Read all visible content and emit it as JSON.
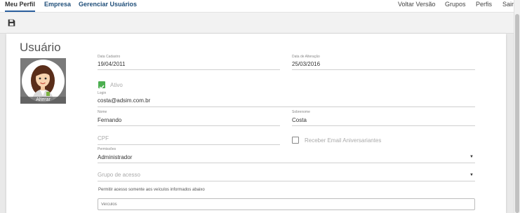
{
  "nav": {
    "left": [
      "Meu Perfil",
      "Empresa",
      "Gerenciar Usuários"
    ],
    "right": [
      "Voltar Versão",
      "Grupos",
      "Perfis",
      "Sair"
    ]
  },
  "page": {
    "title": "Usuário",
    "avatar_label": "Alterar"
  },
  "form": {
    "data_cadastro": {
      "label": "Data Cadastro",
      "value": "19/04/2011"
    },
    "data_alteracao": {
      "label": "Data de Alteração",
      "value": "25/03/2016"
    },
    "ativo": {
      "label": "Ativo",
      "checked": true
    },
    "login": {
      "label": "Login",
      "value": "costa@adsim.com.br"
    },
    "nome": {
      "label": "Nome",
      "value": "Fernando"
    },
    "sobrenome": {
      "label": "Sobrenome",
      "value": "Costa"
    },
    "cpf": {
      "placeholder": "CPF"
    },
    "receber_email": {
      "label": "Receber Email Aniversariantes",
      "checked": false
    },
    "permissoes": {
      "label": "Permissões",
      "value": "Administrador"
    },
    "grupo_acesso": {
      "placeholder": "Grupo de acesso"
    },
    "help_veiculos": "Permitir acesso somente aos veículos informados abaixo",
    "veiculos": {
      "placeholder": "Veículos"
    }
  },
  "colors": {
    "accent": "#2b5f9e",
    "checkbox_green": "#4caf50"
  }
}
